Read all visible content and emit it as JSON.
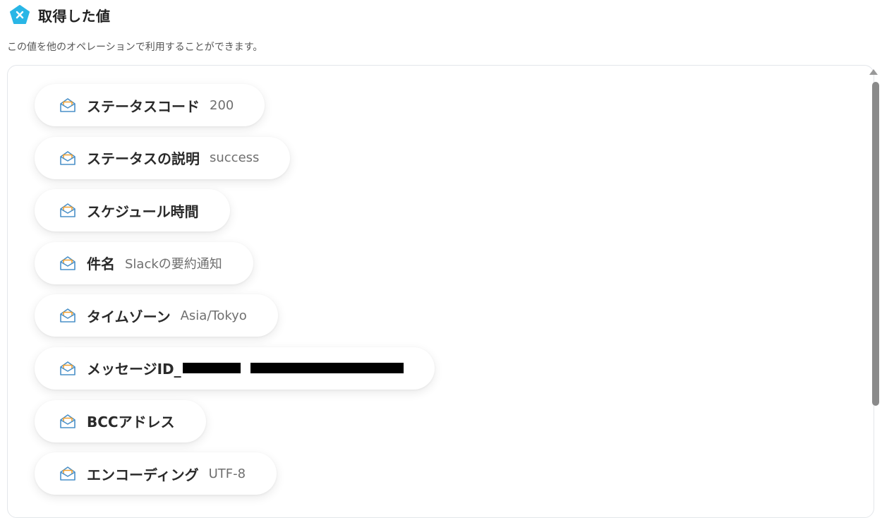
{
  "header": {
    "title": "取得した値",
    "description": "この値を他のオペレーションで利用することができます。"
  },
  "outputs": [
    {
      "label": "ステータスコード",
      "value": "200"
    },
    {
      "label": "ステータスの説明",
      "value": "success"
    },
    {
      "label": "スケジュール時間",
      "value": ""
    },
    {
      "label": "件名",
      "value": "Slackの要約通知"
    },
    {
      "label": "タイムゾーン",
      "value": "Asia/Tokyo"
    },
    {
      "label": "メッセージID_",
      "value": "",
      "redacted": true
    },
    {
      "label": "BCCアドレス",
      "value": ""
    },
    {
      "label": "エンコーディング",
      "value": "UTF-8"
    }
  ],
  "icons": {
    "logo": "yoom-logo-icon",
    "item": "envelope-open-icon"
  },
  "colors": {
    "logo": "#29b6e6",
    "icon_stroke": "#4a90c8",
    "icon_accent": "#f0a030"
  }
}
